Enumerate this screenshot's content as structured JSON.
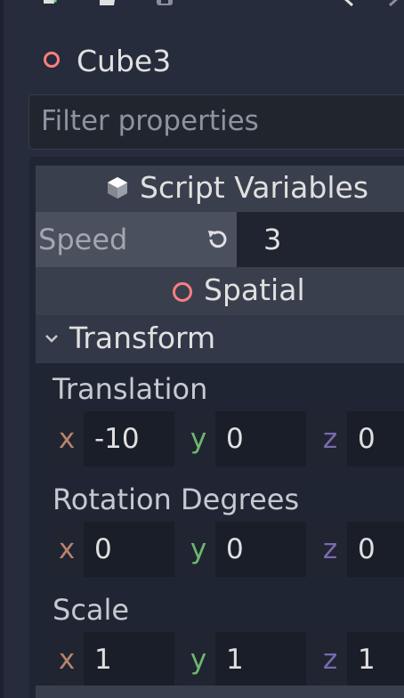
{
  "node": {
    "name": "Cube3",
    "icon": "spatial-node-icon",
    "icon_color": "#fc7f7f"
  },
  "filter": {
    "placeholder": "Filter properties"
  },
  "script_section": {
    "label": "Script Variables",
    "icon": "cube-icon"
  },
  "speed": {
    "label": "Speed",
    "value": "3",
    "icon": "revert-icon"
  },
  "spatial_section": {
    "label": "Spatial"
  },
  "transform_section": {
    "label": "Transform",
    "expanded": true
  },
  "translation": {
    "label": "Translation",
    "x": "-10",
    "y": "0",
    "z": "0"
  },
  "rotation": {
    "label": "Rotation Degrees",
    "x": "0",
    "y": "0",
    "z": "0"
  },
  "scale": {
    "label": "Scale",
    "x": "1",
    "y": "1",
    "z": "1"
  },
  "axis_labels": {
    "x": "x",
    "y": "y",
    "z": "z"
  },
  "colors": {
    "axis_x": "#b8846c",
    "axis_y": "#6fb86f",
    "axis_z": "#7a6ab0",
    "background": "#262c3b"
  }
}
